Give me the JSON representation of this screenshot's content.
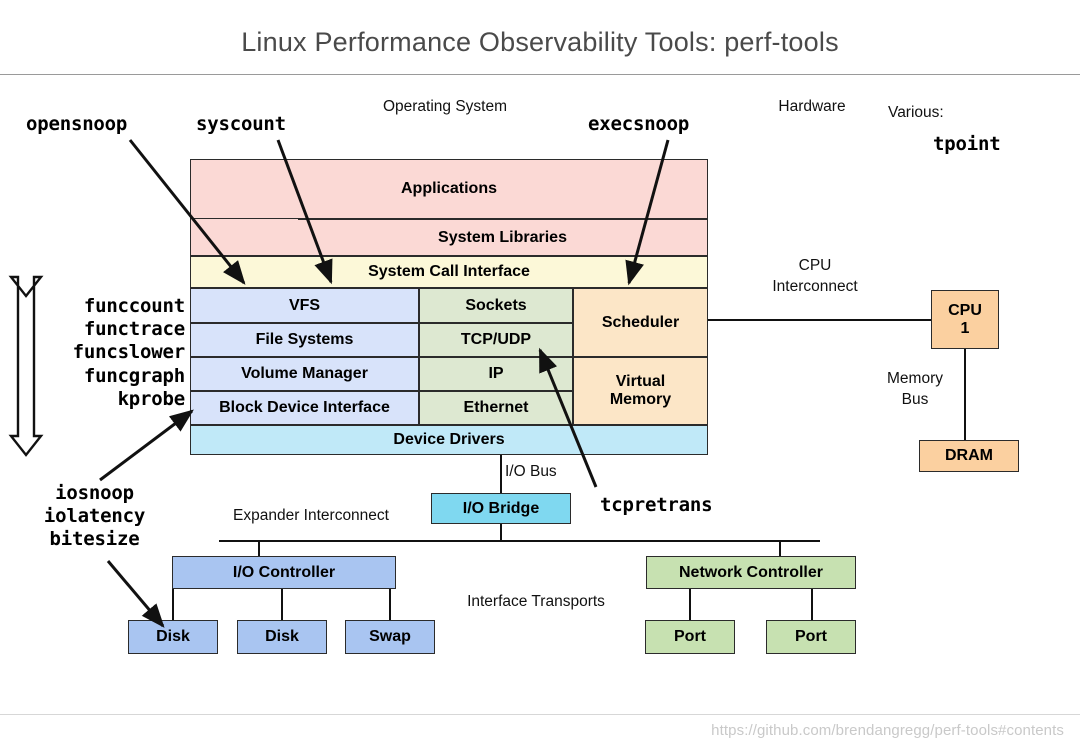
{
  "header": {
    "title": "Linux Performance Observability Tools: perf-tools"
  },
  "footer": {
    "url": "https://github.com/brendangregg/perf-tools#contents"
  },
  "section_labels": {
    "operating_system": "Operating System",
    "hardware": "Hardware",
    "various": "Various:"
  },
  "tools": {
    "opensnoop": "opensnoop",
    "syscount": "syscount",
    "execsnoop": "execsnoop",
    "tpoint": "tpoint",
    "tcpretrans": "tcpretrans",
    "func_group": "funccount\nfunctrace\nfuncslower\nfuncgraph\nkprobe",
    "func_lines": [
      "funccount",
      "functrace",
      "funcslower",
      "funcgraph",
      "kprobe"
    ],
    "io_group": "iosnoop\niolatency\nbitesize",
    "io_lines": [
      "iosnoop",
      "iolatency",
      "bitesize"
    ]
  },
  "stack": {
    "applications": "Applications",
    "system_libraries": "System Libraries",
    "system_call_interface": "System Call Interface",
    "vfs": "VFS",
    "file_systems": "File Systems",
    "volume_manager": "Volume Manager",
    "block_device_interface": "Block Device Interface",
    "sockets": "Sockets",
    "tcp_udp": "TCP/UDP",
    "ip": "IP",
    "ethernet": "Ethernet",
    "scheduler": "Scheduler",
    "virtual_memory": "Virtual\nMemory",
    "virtual_memory_line1": "Virtual",
    "virtual_memory_line2": "Memory",
    "device_drivers": "Device Drivers"
  },
  "hardware": {
    "cpu_interconnect_line1": "CPU",
    "cpu_interconnect_line2": "Interconnect",
    "cpu_line1": "CPU",
    "cpu_line2": "1",
    "memory_bus_line1": "Memory",
    "memory_bus_line2": "Bus",
    "dram": "DRAM"
  },
  "io": {
    "io_bus": "I/O Bus",
    "io_bridge": "I/O Bridge",
    "expander_interconnect": "Expander Interconnect",
    "io_controller": "I/O Controller",
    "interface_transports": "Interface Transports",
    "disk_1": "Disk",
    "disk_2": "Disk",
    "swap": "Swap",
    "network_controller": "Network Controller",
    "port_1": "Port",
    "port_2": "Port"
  },
  "colors": {
    "pink": "#fbd9d5",
    "yellow": "#fcf8d8",
    "blue": "#d8e3fa",
    "green": "#dde8d1",
    "orange": "#fce6c7",
    "cyan": "#c0e9f8",
    "bright_cyan": "#7fd8f0",
    "mid_blue": "#a9c5f1",
    "mid_green": "#c7e1b1",
    "peach": "#fbd0a0",
    "title_gray": "#4a4a4a",
    "footer_gray": "#c9c9c9"
  }
}
